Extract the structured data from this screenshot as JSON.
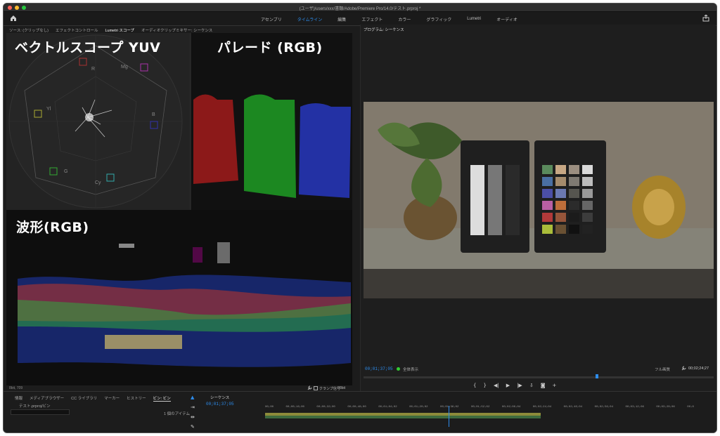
{
  "window": {
    "title": "(ユーザ)/users/xxx/書類/Adobe/Premiere Pro/14.0/テスト.prproj *"
  },
  "workspace_tabs": [
    {
      "label": "アセンブリ",
      "active": false
    },
    {
      "label": "タイムライン",
      "active": true
    },
    {
      "label": "編集",
      "active": false
    },
    {
      "label": "エフェクト",
      "active": false
    },
    {
      "label": "カラー",
      "active": false
    },
    {
      "label": "グラフィック",
      "active": false
    },
    {
      "label": "Lumetri",
      "active": false
    },
    {
      "label": "オーディオ",
      "active": false
    }
  ],
  "scopes_panel": {
    "tabs": [
      "ソース: (クリップなし)",
      "エフェクトコントロール",
      "Lumetri スコープ",
      "オーディオクリップミキサー: シーケンス"
    ],
    "active_tab": 2,
    "vectorscope_label": "ベクトルスコープ YUV",
    "parade_label": "パレード (RGB)",
    "waveform_label": "波形(RGB)",
    "vector_targets": [
      "R",
      "Mg",
      "B",
      "Cy",
      "G",
      "Yl"
    ],
    "footer_left": "8bit, 709",
    "clamp_label": "クランプ信号",
    "footer_right": "8bit"
  },
  "program_monitor": {
    "title": "プログラム: シーケンス",
    "timecode_current": "00;01;37;05",
    "zoom": "全体表示",
    "quality": "フル画質",
    "timecode_total": "00;02;24;27"
  },
  "project_panel": {
    "tabs": [
      "情報",
      "メディアブラウザー",
      "CC ライブラリ",
      "マーカー",
      "ヒストリー",
      "ビン: ビン"
    ],
    "active_tab": 5,
    "path": "テスト.prproj/ビン",
    "search_placeholder": "",
    "item_count": "1 個のアイテム"
  },
  "timeline": {
    "tab": "シーケンス",
    "timecode": "00;01;37;05",
    "ruler": [
      "00;00",
      "00;00;16;00",
      "00;00;32;00",
      "00;00;48;00",
      "00;01;04;02",
      "00;01;20;02",
      "00;01;36;02",
      "00;01;52;02",
      "00;02;08;04",
      "00;02;24;04",
      "00;02;40;04",
      "00;02;56;04",
      "00;03;12;06",
      "00;03;28;06",
      "00;0"
    ]
  },
  "colors": {
    "accent": "#2d8ceb",
    "bg": "#1c1c1c"
  }
}
